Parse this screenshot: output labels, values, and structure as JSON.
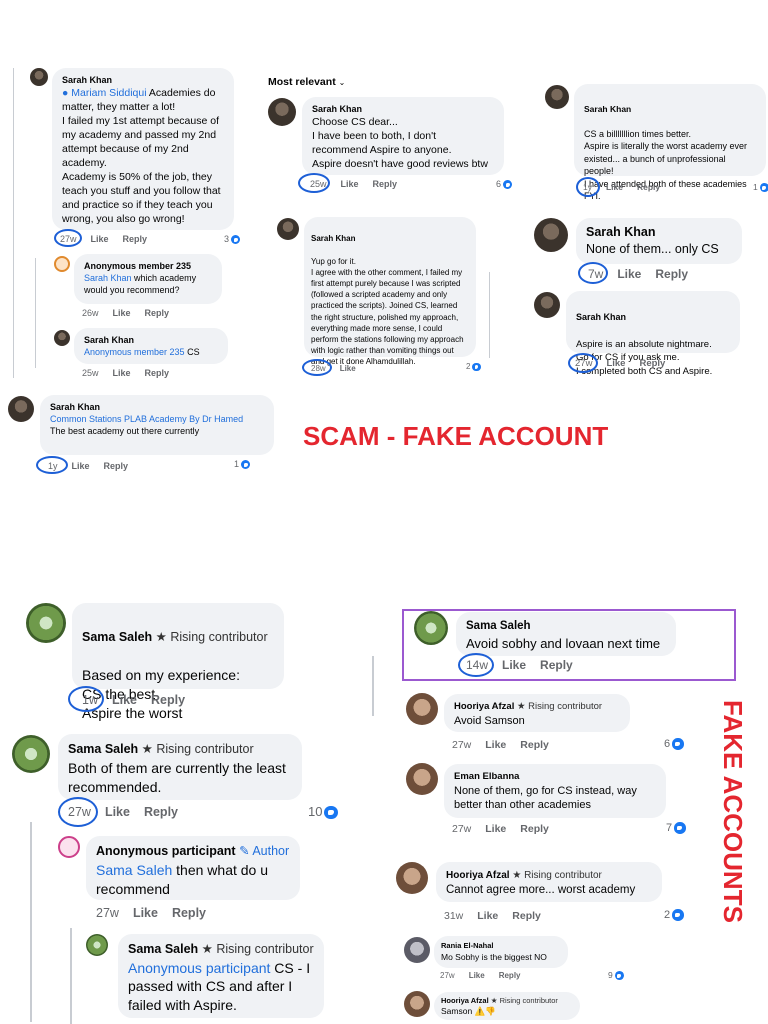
{
  "top_left": {
    "c1": {
      "name": "Sarah Khan",
      "mention": "Mariam Siddiqui",
      "text1": " Academies do matter, they matter a lot!",
      "text2": "I failed my 1st attempt because of my academy and passed my 2nd attempt because of my 2nd academy.",
      "text3": "Academy is 50% of the job, they teach you stuff and you follow that and practice so if they teach you wrong, you also go wrong!",
      "time": "27w",
      "like": "Like",
      "reply": "Reply",
      "reactions": "3"
    },
    "c2": {
      "name": "Anonymous member 235",
      "mention": "Sarah Khan",
      "text": " which academy would you recommend?",
      "time": "26w",
      "like": "Like",
      "reply": "Reply"
    },
    "c3": {
      "name": "Sarah Khan",
      "mention": "Anonymous member 235",
      "text": " CS",
      "time": "25w",
      "like": "Like",
      "reply": "Reply"
    },
    "c4": {
      "name": "Sarah Khan",
      "mention": "Common Stations PLAB Academy By Dr Hamed",
      "text": "The best academy out there currently",
      "time": "1y",
      "like": "Like",
      "reply": "Reply",
      "reactions": "1"
    }
  },
  "top_mid": {
    "sort_label": "Most relevant",
    "c1": {
      "name": "Sarah Khan",
      "lines": [
        "Choose CS dear...",
        "I have been to both, I don't recommend Aspire to anyone.",
        "Aspire doesn't have good reviews btw"
      ],
      "time": "25w",
      "like": "Like",
      "reply": "Reply",
      "reactions": "6"
    },
    "c2": {
      "name": "Sarah Khan",
      "text": "Yup go for it.\nI agree with the other comment, I failed my first attempt purely because I was scripted (followed a scripted academy and only practiced the scripts). Joined CS, learned the right structure, polished my approach, everything made more sense, I could perform the stations following my approach with logic rather than vomiting things out and get it done Alhamdulillah.",
      "time": "28w",
      "like": "Like",
      "reactions": "2"
    }
  },
  "top_right": {
    "c1": {
      "name": "Sarah Khan",
      "text": "CS a billlllllion times better.\nAspire is literally the worst academy ever existed... a bunch of unprofessional people!\nI have attended both of these academies FYI.",
      "time": "1y",
      "like": "Like",
      "reply": "Reply",
      "reactions": "1"
    },
    "c2": {
      "name": "Sarah Khan",
      "text": "None of them... only CS",
      "time": "7w",
      "like": "Like",
      "reply": "Reply"
    },
    "c3": {
      "name": "Sarah Khan",
      "text": "Aspire is an absolute nightmare.\nGo for CS if you ask me.\nI completed both CS and Aspire.",
      "time": "27w",
      "like": "Like",
      "reply": "Reply"
    }
  },
  "stamp_scam": "SCAM - FAKE ACCOUNT",
  "stamp_fake": "FAKE ACCOUNTS",
  "bottom_left": {
    "c1": {
      "name": "Sama Saleh",
      "badge": "Rising contributor",
      "text": "Based on my experience:\nCS the best\nAspire the worst",
      "time": "1w",
      "like": "Like",
      "reply": "Reply"
    },
    "c2": {
      "name": "Sama Saleh",
      "badge": "Rising contributor",
      "text": "Both of them are currently the least recommended.",
      "time": "27w",
      "like": "Like",
      "reply": "Reply",
      "reactions": "10"
    },
    "c3": {
      "name": "Anonymous participant",
      "badge": "Author",
      "mention": "Sama Saleh",
      "text": " then what do u recommend",
      "time": "27w",
      "like": "Like",
      "reply": "Reply"
    },
    "c4": {
      "name": "Sama Saleh",
      "badge": "Rising contributor",
      "mention": "Anonymous participant",
      "text": " CS - I passed with CS and after I failed with Aspire."
    }
  },
  "bottom_right": {
    "c1": {
      "name": "Sama Saleh",
      "text": "Avoid sobhy and lovaan next time",
      "time": "14w",
      "like": "Like",
      "reply": "Reply"
    },
    "c2": {
      "name": "Hooriya Afzal",
      "badge": "Rising contributor",
      "text": "Avoid Samson",
      "time": "27w",
      "like": "Like",
      "reply": "Reply",
      "reactions": "6"
    },
    "c3": {
      "name": "Eman Elbanna",
      "text": "None of them, go for CS instead, way better than other academies",
      "time": "27w",
      "like": "Like",
      "reply": "Reply",
      "reactions": "7"
    },
    "c4": {
      "name": "Hooriya Afzal",
      "badge": "Rising contributor",
      "text": "Cannot agree more... worst academy",
      "time": "31w",
      "like": "Like",
      "reply": "Reply",
      "reactions": "2"
    },
    "c5": {
      "name": "Rania El-Nahal",
      "text": "Mo Sobhy is the biggest NO",
      "time": "27w",
      "like": "Like",
      "reply": "Reply",
      "reactions": "9"
    },
    "c6": {
      "name": "Hooriya Afzal",
      "badge": "Rising contributor",
      "text": "Samson ⚠️👎"
    }
  },
  "colors": {
    "bubble": "#f0f2f5",
    "link": "#216fdb",
    "meta": "#65676b",
    "stamp": "#e4262f",
    "annotation": "#1d5fd6",
    "highlight": "#9b59d0"
  }
}
